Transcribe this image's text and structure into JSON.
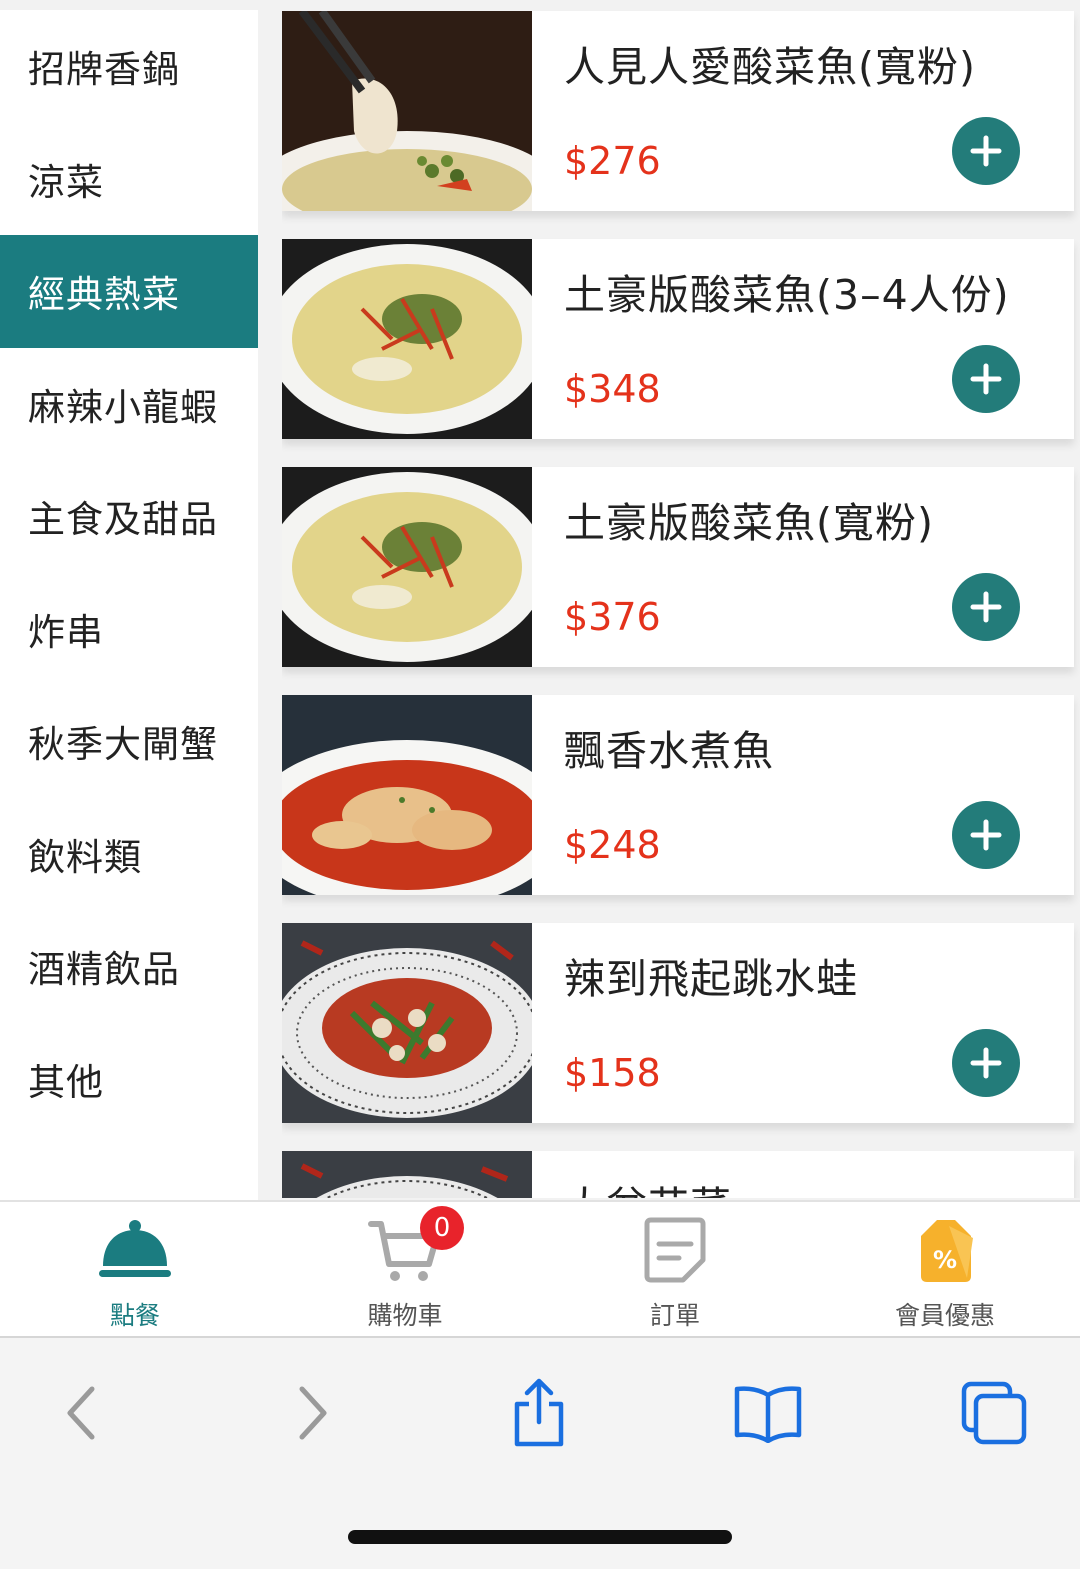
{
  "categories": [
    {
      "label": "招牌香鍋"
    },
    {
      "label": "涼菜"
    },
    {
      "label": "經典熱菜"
    },
    {
      "label": "麻辣小龍蝦"
    },
    {
      "label": "主食及甜品"
    },
    {
      "label": "炸串"
    },
    {
      "label": "秋季大閘蟹"
    },
    {
      "label": "飲料類"
    },
    {
      "label": "酒精飲品"
    },
    {
      "label": "其他"
    }
  ],
  "active_category": "經典熱菜",
  "menu_items": [
    {
      "name": "人見人愛酸菜魚(寬粉)",
      "price": "$276"
    },
    {
      "name": "土豪版酸菜魚(3–4人份)",
      "price": "$348"
    },
    {
      "name": "土豪版酸菜魚(寬粉)",
      "price": "$376"
    },
    {
      "name": "飄香水煮魚",
      "price": "$248"
    },
    {
      "name": "辣到飛起跳水蛙",
      "price": "$158"
    },
    {
      "name": "大盆花菜",
      "price": ""
    }
  ],
  "tabbar": {
    "order": {
      "label": "點餐",
      "icon": "cloche-icon"
    },
    "cart": {
      "label": "購物車",
      "icon": "cart-icon",
      "badge": "0"
    },
    "orders": {
      "label": "訂單",
      "icon": "receipt-icon"
    },
    "member": {
      "label": "會員優惠",
      "icon": "discount-tag-icon"
    }
  },
  "browser": {
    "icons": [
      "back-icon",
      "forward-icon",
      "share-icon",
      "bookmarks-icon",
      "tabs-icon"
    ]
  },
  "colors": {
    "accent": "#1b7c80",
    "add_button": "#237c7a",
    "price": "#e4321b",
    "badge": "#e8232b",
    "member_icon": "#f6b12c"
  }
}
